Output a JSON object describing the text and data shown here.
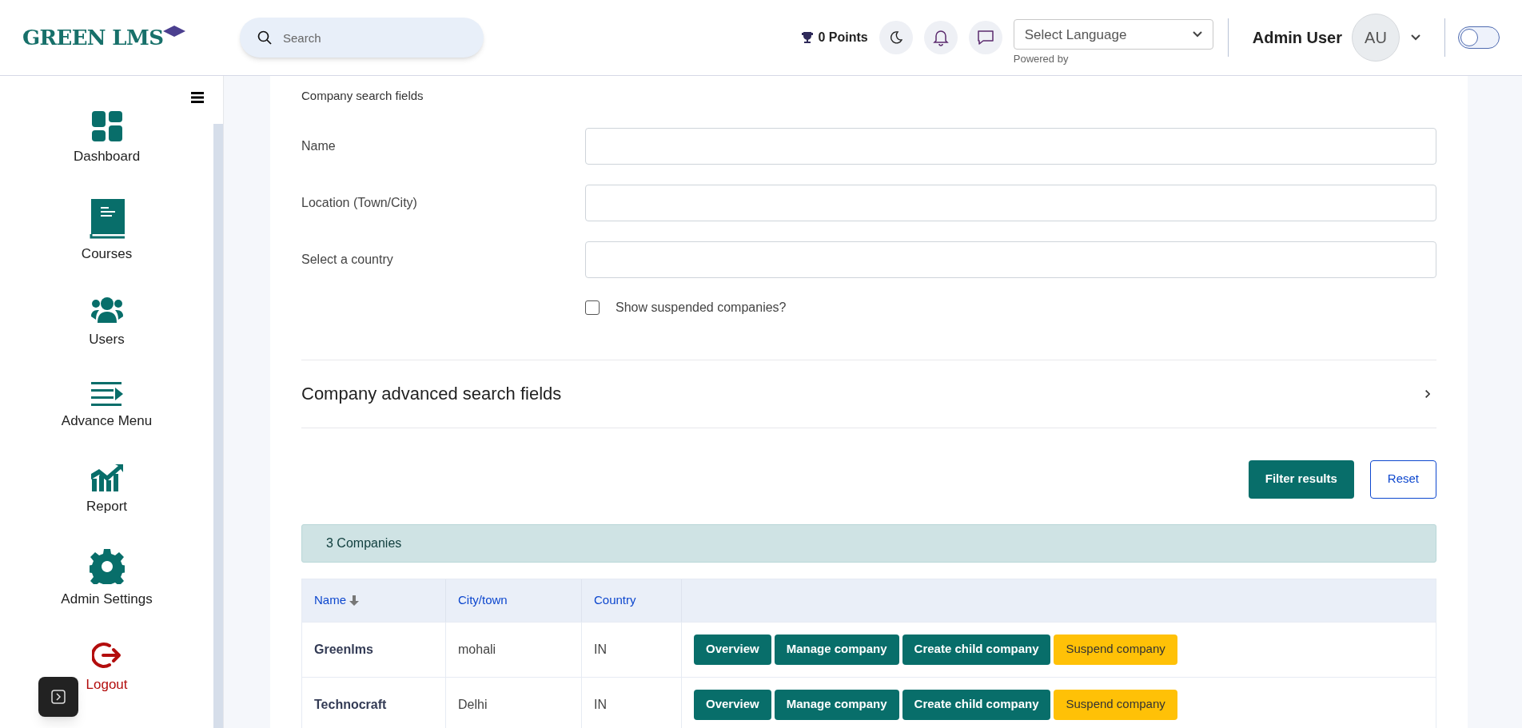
{
  "header": {
    "logo_text": "GREEN LMS",
    "search": {
      "placeholder": "Search"
    },
    "points": "0 Points",
    "language": {
      "value": "Select Language",
      "note": "Powered by"
    },
    "user": {
      "name": "Admin User",
      "initials": "AU"
    },
    "toggle": {
      "on": false
    }
  },
  "sidebar": {
    "items": [
      {
        "label": "Dashboard",
        "kind": "dashboard"
      },
      {
        "label": "Courses",
        "kind": "courses"
      },
      {
        "label": "Users",
        "kind": "users"
      },
      {
        "label": "Advance Menu",
        "kind": "menu"
      },
      {
        "label": "Report",
        "kind": "report"
      },
      {
        "label": "Admin Settings",
        "kind": "settings"
      },
      {
        "label": "Logout",
        "kind": "logout"
      }
    ]
  },
  "search_form": {
    "title": "Company search fields",
    "fields": [
      {
        "label": "Name"
      },
      {
        "label": "Location (Town/City)"
      },
      {
        "label": "Select a country"
      }
    ],
    "checkbox": {
      "label": "Show suspended companies?",
      "checked": false
    },
    "advanced": {
      "title": "Company advanced search fields",
      "expanded": false
    },
    "buttons": [
      {
        "label": "Filter results",
        "kind": "primary"
      },
      {
        "label": "Reset",
        "kind": "outline"
      }
    ]
  },
  "results": {
    "count": "3 Companies",
    "columns": [
      "Name",
      "City/town",
      "Country"
    ],
    "rows": [
      {
        "name": "Greenlms",
        "city": "mohali",
        "country": "IN",
        "actions": [
          {
            "label": "Overview",
            "kind": "primary"
          },
          {
            "label": "Manage company",
            "kind": "primary"
          },
          {
            "label": "Create child company",
            "kind": "primary"
          },
          {
            "label": "Suspend company",
            "kind": "warning"
          }
        ]
      },
      {
        "name": "Technocraft",
        "city": "Delhi",
        "country": "IN",
        "actions": [
          {
            "label": "Overview",
            "kind": "primary"
          },
          {
            "label": "Manage company",
            "kind": "primary"
          },
          {
            "label": "Create child company",
            "kind": "primary"
          },
          {
            "label": "Suspend company",
            "kind": "warning"
          }
        ]
      }
    ]
  }
}
